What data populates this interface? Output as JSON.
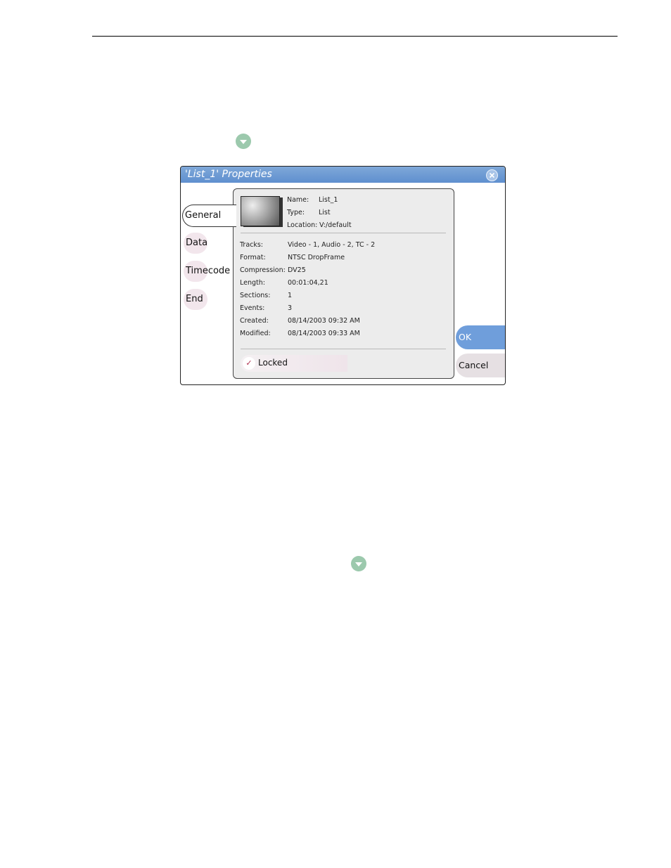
{
  "dialog": {
    "title": "'List_1' Properties",
    "tabs": [
      "General",
      "Data",
      "Timecode",
      "End"
    ],
    "active_tab": "General",
    "general": {
      "name_label": "Name:",
      "name_value": "List_1",
      "type_label": "Type:",
      "type_value": "List",
      "location_label": "Location:",
      "location_value": "V:/default",
      "tracks_label": "Tracks:",
      "tracks_value": "Video - 1, Audio - 2, TC - 2",
      "format_label": "Format:",
      "format_value": "NTSC DropFrame",
      "compression_label": "Compression:",
      "compression_value": "DV25",
      "length_label": "Length:",
      "length_value": "00:01:04,21",
      "sections_label": "Sections:",
      "sections_value": "1",
      "events_label": "Events:",
      "events_value": "3",
      "created_label": "Created:",
      "created_value": "08/14/2003 09:32 AM",
      "modified_label": "Modified:",
      "modified_value": "08/14/2003 09:33 AM",
      "locked_label": "Locked",
      "locked_checked": true
    },
    "ok_label": "OK",
    "cancel_label": "Cancel"
  },
  "colors": {
    "title_bar": "#6f9edb",
    "ok_button": "#6f9edb",
    "menu_icon": "#9cc9ad"
  },
  "icons": [
    "dropdown-arrow-icon",
    "close-icon",
    "check-icon",
    "clip-thumbnail"
  ]
}
